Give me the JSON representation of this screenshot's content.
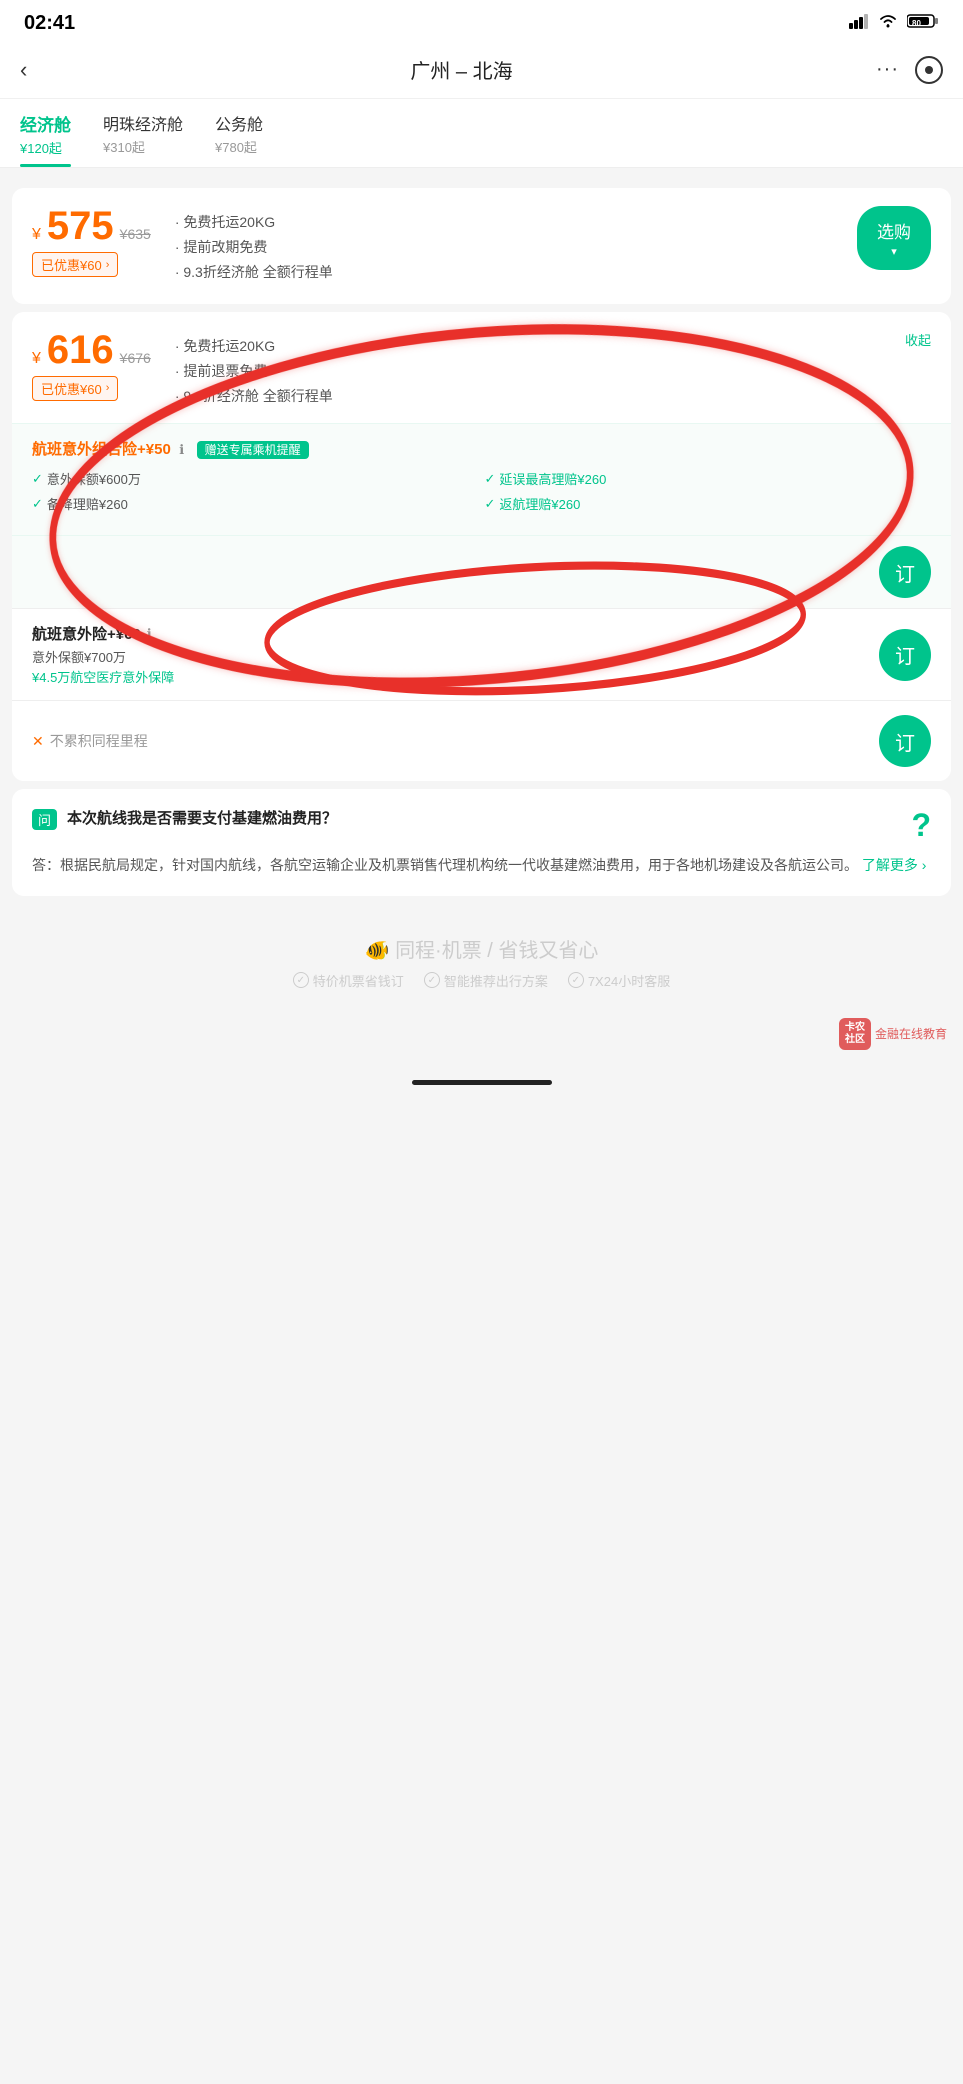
{
  "statusBar": {
    "time": "02:41",
    "battery": "80"
  },
  "header": {
    "backLabel": "‹",
    "title": "广州 – 北海",
    "moreLabel": "···",
    "cameraLabel": "⊙"
  },
  "cabinTabs": [
    {
      "name": "经济舱",
      "price": "¥120起",
      "active": true
    },
    {
      "name": "明珠经济舱",
      "price": "¥310起",
      "active": false
    },
    {
      "name": "公务舱",
      "price": "¥780起",
      "active": false
    }
  ],
  "flightCard1": {
    "priceSymbol": "¥",
    "priceAmount": "575",
    "priceOriginal": "¥635",
    "discountBadge": "已优惠¥60",
    "features": [
      "免费托运20KG",
      "提前改期免费",
      "9.3折经济舱  全额行程单"
    ],
    "selectBtn": "选购"
  },
  "flightCard2": {
    "priceSymbol": "¥",
    "priceAmount": "616",
    "priceOriginal": "¥676",
    "discountBadge": "已优惠¥60",
    "collapseBtn": "收起",
    "features": [
      "免费托运20KG",
      "提前退票免费",
      "9.8折经济舱  全额行程单"
    ]
  },
  "insurance1": {
    "title": "航班意外组合险+¥50",
    "giftBadge": "赠送专属乘机提醒",
    "features": [
      {
        "text": "意外保额¥600万"
      },
      {
        "text": "延误最高理赔¥260",
        "highlight": true
      },
      {
        "text": "备降理赔¥260"
      },
      {
        "text": "返航理赔¥260",
        "highlight": true
      }
    ],
    "orderBtn": "订"
  },
  "insurance2": {
    "title": "航班意外险+¥60",
    "infoIcon": "ℹ",
    "desc1": "意外保额¥700万",
    "desc2": "¥4.5万航空医疗意外保障",
    "orderBtn": "订"
  },
  "noAccumulate": {
    "text": "不累积同程里程",
    "orderBtn": "订"
  },
  "faq": {
    "qIcon": "问",
    "question": "本次航线我是否需要支付基建燃油费用？",
    "answer": "答：根据民航局规定，针对国内航线，各航空运输企业及机票销售代理机构统一代收基建燃油费用，用于各地机场建设及各航运公司。",
    "linkText": "了解更多 ›"
  },
  "footer": {
    "logo": "🐠 同程·机票 / 省钱又省心",
    "features": [
      "特价机票省钱订",
      "智能推荐出行方案",
      "7X24小时客服"
    ]
  },
  "watermark": {
    "iconText": "卡农\n社区",
    "text": "金融在线教育"
  }
}
